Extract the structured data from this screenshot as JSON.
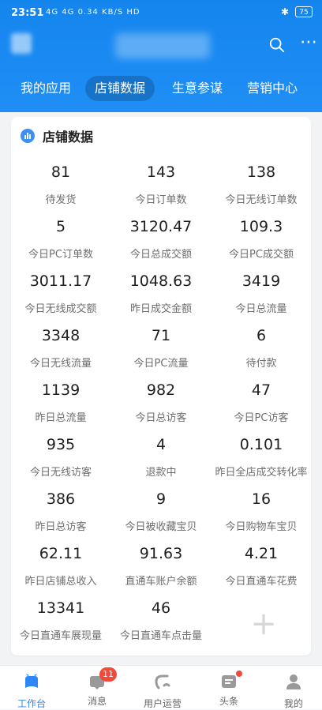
{
  "status_bar": {
    "time": "23:51",
    "signal_text": "4G 4G",
    "network_text": "0.34 KB/S HD",
    "battery": "75"
  },
  "header": {
    "tabs": [
      {
        "label": "我的应用"
      },
      {
        "label": "店铺数据"
      },
      {
        "label": "生意参谋"
      },
      {
        "label": "营销中心"
      }
    ]
  },
  "card": {
    "title": "店铺数据",
    "metrics": [
      {
        "value": "81",
        "label": "待发货"
      },
      {
        "value": "143",
        "label": "今日订单数"
      },
      {
        "value": "138",
        "label": "今日无线订单数"
      },
      {
        "value": "5",
        "label": "今日PC订单数"
      },
      {
        "value": "3120.47",
        "label": "今日总成交额"
      },
      {
        "value": "109.3",
        "label": "今日PC成交额"
      },
      {
        "value": "3011.17",
        "label": "今日无线成交额"
      },
      {
        "value": "1048.63",
        "label": "昨日成交金额"
      },
      {
        "value": "3419",
        "label": "今日总流量"
      },
      {
        "value": "3348",
        "label": "今日无线流量"
      },
      {
        "value": "71",
        "label": "今日PC流量"
      },
      {
        "value": "6",
        "label": "待付款"
      },
      {
        "value": "1139",
        "label": "昨日总流量"
      },
      {
        "value": "982",
        "label": "今日总访客"
      },
      {
        "value": "47",
        "label": "今日PC访客"
      },
      {
        "value": "935",
        "label": "今日无线访客"
      },
      {
        "value": "4",
        "label": "退款中"
      },
      {
        "value": "0.101",
        "label": "昨日全店成交转化率"
      },
      {
        "value": "386",
        "label": "昨日总访客"
      },
      {
        "value": "9",
        "label": "今日被收藏宝贝"
      },
      {
        "value": "16",
        "label": "今日购物车宝贝"
      },
      {
        "value": "62.11",
        "label": "昨日店铺总收入"
      },
      {
        "value": "91.63",
        "label": "直通车账户余额"
      },
      {
        "value": "4.21",
        "label": "今日直通车花费"
      },
      {
        "value": "13341",
        "label": "今日直通车展现量"
      },
      {
        "value": "46",
        "label": "今日直通车点击量"
      }
    ]
  },
  "bottom_nav": [
    {
      "label": "工作台"
    },
    {
      "label": "消息",
      "badge": "11"
    },
    {
      "label": "用户运营"
    },
    {
      "label": "头条"
    },
    {
      "label": "我的"
    }
  ],
  "colors": {
    "primary": "#1f8ff6",
    "active_nav": "#2f86f6",
    "badge": "#f04a3d"
  }
}
